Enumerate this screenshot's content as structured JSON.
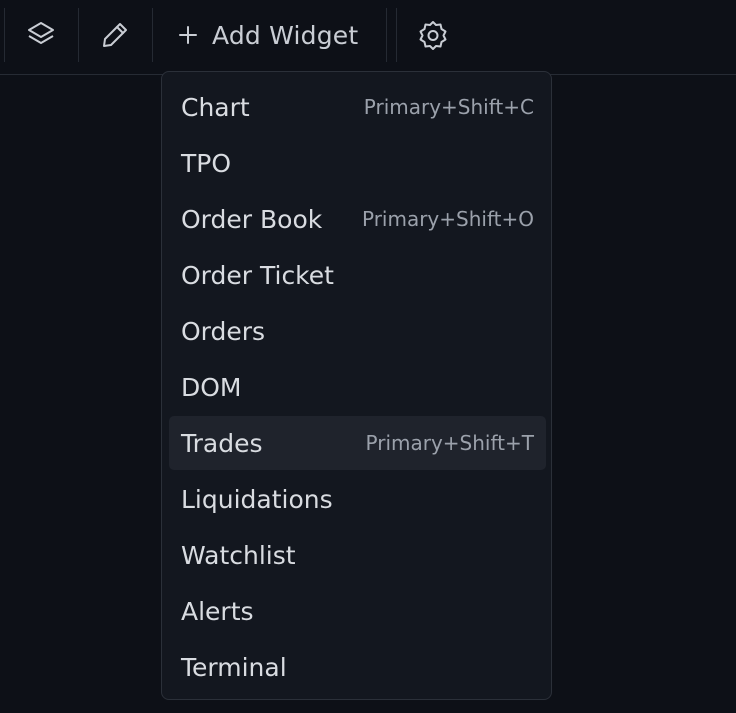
{
  "toolbar": {
    "add_widget_label": "Add Widget",
    "icons": [
      "layers-icon",
      "pencil-icon",
      "plus-icon",
      "gear-icon"
    ]
  },
  "menu": {
    "items": [
      {
        "label": "Chart",
        "shortcut": "Primary+Shift+C",
        "active": false
      },
      {
        "label": "TPO",
        "shortcut": "",
        "active": false
      },
      {
        "label": "Order Book",
        "shortcut": "Primary+Shift+O",
        "active": false
      },
      {
        "label": "Order Ticket",
        "shortcut": "",
        "active": false
      },
      {
        "label": "Orders",
        "shortcut": "",
        "active": false
      },
      {
        "label": "DOM",
        "shortcut": "",
        "active": false
      },
      {
        "label": "Trades",
        "shortcut": "Primary+Shift+T",
        "active": true
      },
      {
        "label": "Liquidations",
        "shortcut": "",
        "active": false
      },
      {
        "label": "Watchlist",
        "shortcut": "",
        "active": false
      },
      {
        "label": "Alerts",
        "shortcut": "",
        "active": false
      },
      {
        "label": "Terminal",
        "shortcut": "",
        "active": false
      }
    ]
  },
  "colors": {
    "background": "#0d1017",
    "menu_background": "#13171f",
    "menu_highlight": "#1f232c",
    "text": "#d9dce1",
    "shortcut_text": "#9ba1ab"
  }
}
